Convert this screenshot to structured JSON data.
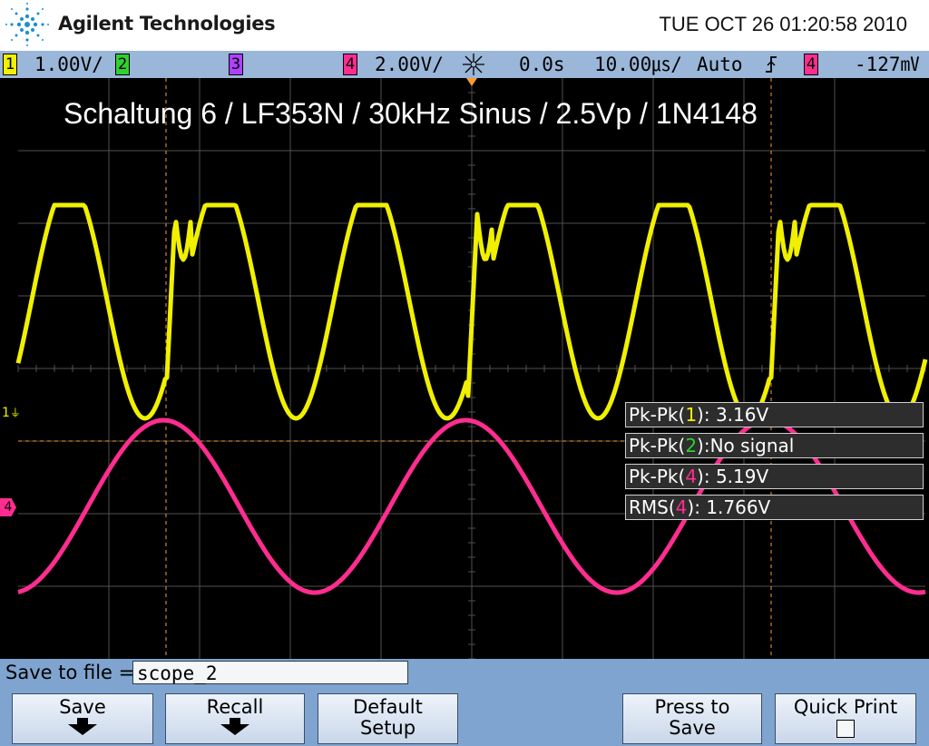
{
  "header": {
    "brand": "Agilent Technologies",
    "datetime": "TUE OCT 26 01:20:58 2010"
  },
  "status": {
    "ch1_num": "1",
    "ch1_scale": "1.00V/",
    "ch2_num": "2",
    "ch3_num": "3",
    "ch4_num": "4",
    "ch4_scale": "2.00V/",
    "delay": "0.0s",
    "timebase": "10.00㎲/",
    "trigger_mode": "Auto",
    "trigger_src": "4",
    "trigger_level": "-127㎷"
  },
  "display": {
    "annotation": "Schaltung 6 / LF353N / 30kHz Sinus / 2.5Vp / 1N4148",
    "ch1_marker": "1",
    "ch4_marker": "4"
  },
  "measurements": [
    {
      "label": "Pk-Pk(",
      "ch": "1",
      "rest": "): 3.16V"
    },
    {
      "label": "Pk-Pk(",
      "ch": "2",
      "rest": "):No signal"
    },
    {
      "label": "Pk-Pk(",
      "ch": "4",
      "rest": "): 5.19V"
    },
    {
      "label": "RMS(",
      "ch": "4",
      "rest": "): 1.766V"
    }
  ],
  "bottom": {
    "save_to_label": "Save to file =",
    "filename": "scope_2",
    "softkeys": {
      "save": "Save",
      "recall": "Recall",
      "default_l1": "Default",
      "default_l2": "Setup",
      "press_l1": "Press to",
      "press_l2": "Save",
      "quick_print": "Quick Print"
    }
  },
  "colors": {
    "ch1": "#f0f000",
    "ch2": "#30d030",
    "ch3": "#b040ff",
    "ch4": "#ff2d8f",
    "screen_bg": "#000000",
    "statusbar": "#9ab6d9",
    "softkey_panel": "#7fa4cf",
    "cursor": "#ff9a30"
  }
}
